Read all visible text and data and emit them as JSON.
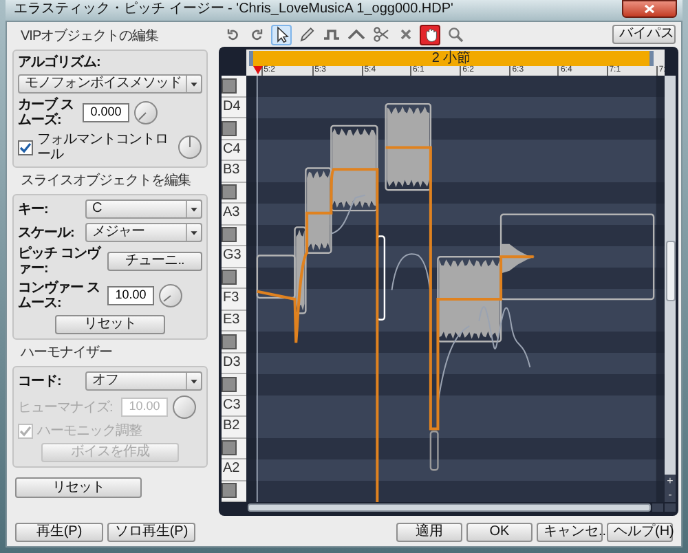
{
  "window": {
    "title": "エラスティック・ピッチ イージー - 'Chris_LoveMusicA 1_ogg000.HDP'"
  },
  "vip_edit": {
    "title": "VIPオブジェクトの編集",
    "algorithm_label": "アルゴリズム:",
    "algorithm_value": "モノフォンボイスメソッド",
    "curve_smooth_label": "カーブ スムーズ:",
    "curve_smooth_value": "0.000",
    "formant_control": {
      "label": "フォルマントコントロール",
      "checked": true
    }
  },
  "slice_edit": {
    "title": "スライスオブジェクトを編集",
    "key_label": "キー:",
    "key_value": "C",
    "scale_label": "スケール:",
    "scale_value": "メジャー",
    "pitch_correct_label": "ピッチ コンヴァー:",
    "pitch_correct_button": "チューニ..",
    "correct_smooth_label": "コンヴァー スムース:",
    "correct_smooth_value": "10.00",
    "reset_button": "リセット"
  },
  "harmonizer": {
    "title": "ハーモナイザー",
    "chord_label": "コード:",
    "chord_value": "オフ",
    "humanize": {
      "label": "ヒューマナイズ:",
      "value": "10.00",
      "disabled": true
    },
    "harmonic_adjust": {
      "label": "ハーモニック調整",
      "checked": true,
      "disabled": true
    },
    "create_voice": {
      "label": "ボイスを作成",
      "disabled": true
    }
  },
  "reset_button": "リセット",
  "toolbar": {
    "tools": [
      {
        "kind": "undo",
        "selected": false,
        "pressed": false
      },
      {
        "kind": "redo",
        "selected": false,
        "pressed": false
      },
      {
        "kind": "select",
        "selected": true,
        "pressed": false
      },
      {
        "kind": "pencil",
        "selected": false,
        "pressed": false
      },
      {
        "kind": "step",
        "selected": false,
        "pressed": false
      },
      {
        "kind": "curve",
        "selected": false,
        "pressed": false
      },
      {
        "kind": "scissors",
        "selected": false,
        "pressed": false
      },
      {
        "kind": "erase",
        "selected": false,
        "pressed": false
      },
      {
        "kind": "hand",
        "selected": false,
        "pressed": true
      },
      {
        "kind": "zoom",
        "selected": false,
        "pressed": false
      }
    ],
    "bypass_button": "バイパス"
  },
  "timeline": {
    "loop_label": "2 小節",
    "ticks": [
      "5:2",
      "5:3",
      "5:4",
      "6:1",
      "6:2",
      "6:3",
      "6:4",
      "7:1",
      "7:"
    ]
  },
  "piano_keys": [
    {
      "kind": "black"
    },
    {
      "kind": "white",
      "label": "D4"
    },
    {
      "kind": "black"
    },
    {
      "kind": "white",
      "label": "C4"
    },
    {
      "kind": "white",
      "label": "B3"
    },
    {
      "kind": "black"
    },
    {
      "kind": "white",
      "label": "A3"
    },
    {
      "kind": "black"
    },
    {
      "kind": "white",
      "label": "G3"
    },
    {
      "kind": "black"
    },
    {
      "kind": "white",
      "label": "F3"
    },
    {
      "kind": "white",
      "label": "E3"
    },
    {
      "kind": "black"
    },
    {
      "kind": "white",
      "label": "D3"
    },
    {
      "kind": "black"
    },
    {
      "kind": "white",
      "label": "C3"
    },
    {
      "kind": "white",
      "label": "B2"
    },
    {
      "kind": "black"
    },
    {
      "kind": "white",
      "label": "A2"
    },
    {
      "kind": "black"
    }
  ],
  "zoom_buttons": [
    "+",
    "-"
  ],
  "footer": {
    "left_buttons": [
      "再生(P)",
      "ソロ再生(P)"
    ],
    "right_buttons": [
      "適用",
      "OK",
      "キャンセ..",
      "ヘルプ(H)"
    ]
  }
}
